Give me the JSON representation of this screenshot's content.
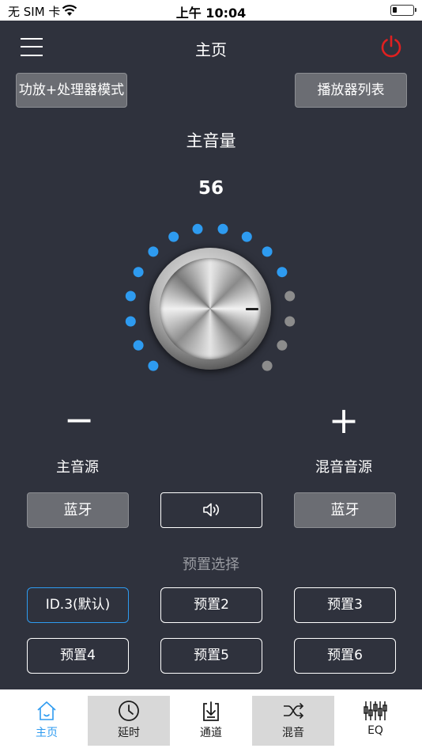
{
  "status_bar": {
    "carrier": "无 SIM 卡",
    "time": "上午 10:04"
  },
  "header": {
    "title": "主页"
  },
  "top_buttons": {
    "mode": "功放+处理器模式",
    "player_list": "播放器列表"
  },
  "volume": {
    "title": "主音量",
    "value": "56",
    "active_dots": 12,
    "total_dots": 16,
    "active_color": "#2e9bf0",
    "inactive_color": "#8c8c8c"
  },
  "controls": {
    "minus": "−",
    "plus": "+"
  },
  "sources": {
    "main_label": "主音源",
    "mix_label": "混音音源",
    "main_value": "蓝牙",
    "mix_value": "蓝牙"
  },
  "presets": {
    "title": "预置选择",
    "items": [
      "ID.3(默认)",
      "预置2",
      "预置3",
      "预置4",
      "预置5",
      "预置6"
    ],
    "active_index": 0
  },
  "tabs": [
    {
      "label": "主页",
      "icon": "home-icon",
      "active": true
    },
    {
      "label": "延时",
      "icon": "clock-icon",
      "active": false
    },
    {
      "label": "通道",
      "icon": "download-icon",
      "active": false
    },
    {
      "label": "混音",
      "icon": "shuffle-icon",
      "active": false
    },
    {
      "label": "EQ",
      "icon": "equalizer-icon",
      "active": false
    }
  ],
  "colors": {
    "background": "#2f323d",
    "accent": "#2e9bf0",
    "power": "#e02020"
  }
}
